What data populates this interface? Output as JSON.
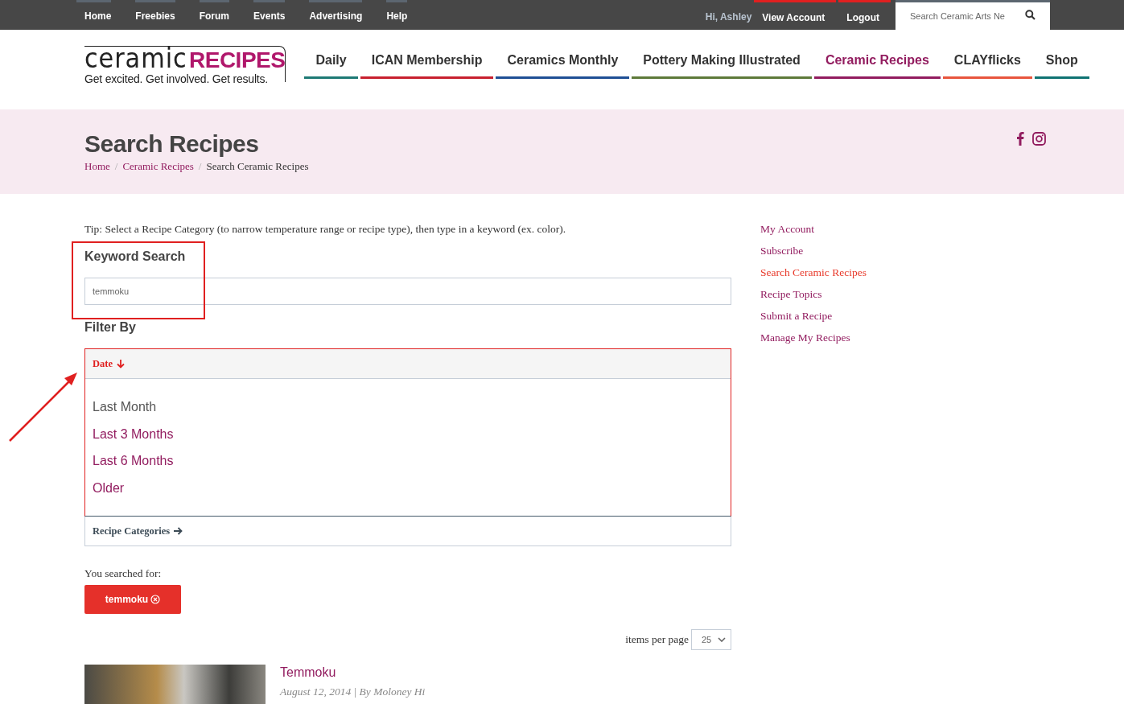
{
  "top_bar": {
    "links": [
      {
        "label": "Home",
        "kind": "site"
      },
      {
        "label": "Freebies",
        "kind": "site"
      },
      {
        "label": "Forum",
        "kind": "site"
      },
      {
        "label": "Events",
        "kind": "site"
      },
      {
        "label": "Advertising",
        "kind": "site"
      },
      {
        "label": "Help",
        "kind": "site"
      }
    ],
    "greeting": "Hi, Ashley",
    "account_links": [
      {
        "label": "View Account",
        "kind": "account"
      },
      {
        "label": "Logout",
        "kind": "account"
      }
    ],
    "search": {
      "placeholder": "Search Ceramic Arts Ne"
    }
  },
  "logo": {
    "word": "ceramic",
    "brand": "RECIPES",
    "tagline": "Get excited. Get involved. Get results."
  },
  "main_nav": [
    {
      "label": "Daily",
      "color": "#1e7a75",
      "selected": false
    },
    {
      "label": "ICAN Membership",
      "color": "#c8202f",
      "selected": false
    },
    {
      "label": "Ceramics Monthly",
      "color": "#1f4f95",
      "selected": false
    },
    {
      "label": "Pottery Making Illustrated",
      "color": "#5e7a3a",
      "selected": false
    },
    {
      "label": "Ceramic Recipes",
      "color": "#921c5f",
      "selected": true
    },
    {
      "label": "CLAYflicks",
      "color": "#e8553d",
      "selected": false
    },
    {
      "label": "Shop",
      "color": "#0f7373",
      "selected": false
    }
  ],
  "page_header": {
    "title": "Search Recipes",
    "separator": "/",
    "breadcrumb": [
      {
        "label": "Home",
        "kind": "link"
      },
      {
        "label": "Ceramic Recipes",
        "kind": "link"
      },
      {
        "label": "Search Ceramic Recipes",
        "kind": "current"
      }
    ]
  },
  "tip": "Tip: Select a Recipe Category (to narrow temperature range or recipe type), then type in a keyword (ex. color).",
  "keyword_search": {
    "heading": "Keyword Search",
    "placeholder": "temmoku"
  },
  "filter": {
    "heading": "Filter By",
    "sections": [
      {
        "label": "Date",
        "expanded": true,
        "options": [
          {
            "label": "Last Month",
            "selected": true
          },
          {
            "label": "Last 3 Months",
            "selected": false
          },
          {
            "label": "Last 6 Months",
            "selected": false
          },
          {
            "label": "Older",
            "selected": false
          }
        ]
      },
      {
        "label": "Recipe Categories",
        "expanded": false
      }
    ]
  },
  "searched_for": {
    "label": "You searched for:",
    "tags": [
      "temmoku"
    ]
  },
  "items_per_page": {
    "label": "items per page",
    "value": "25"
  },
  "results": [
    {
      "title": "Temmoku",
      "meta": "August 12, 2014 | By Moloney Hi"
    }
  ],
  "sidebar": {
    "items": [
      {
        "label": "My Account",
        "selected": false
      },
      {
        "label": "Subscribe",
        "selected": false
      },
      {
        "label": "Search Ceramic Recipes",
        "selected": true
      },
      {
        "label": "Recipe Topics",
        "selected": false
      },
      {
        "label": "Submit a Recipe",
        "selected": false
      },
      {
        "label": "Manage My Recipes",
        "selected": false
      }
    ]
  }
}
